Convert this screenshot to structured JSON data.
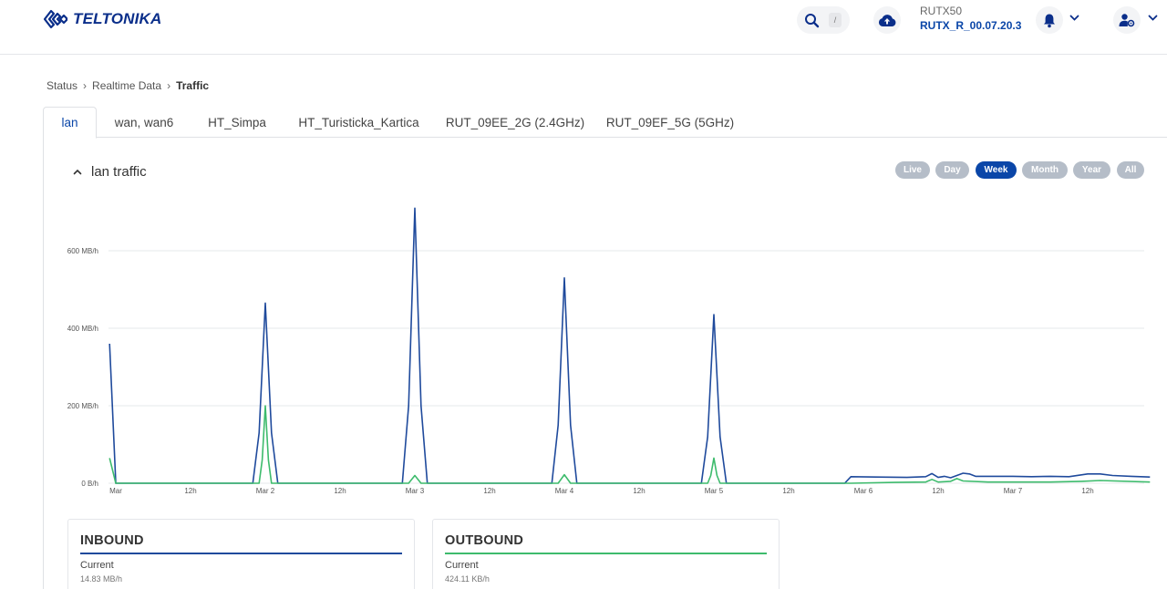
{
  "header": {
    "brand": "TELTONIKA",
    "search_shortcut": "/",
    "device_name": "RUTX50",
    "firmware": "RUTX_R_00.07.20.3"
  },
  "breadcrumb": [
    "Status",
    "Realtime Data",
    "Traffic"
  ],
  "tabs": [
    "lan",
    "wan, wan6",
    "HT_Simpa",
    "HT_Turisticka_Kartica",
    "RUT_09EE_2G (2.4GHz)",
    "RUT_09EF_5G (5GHz)"
  ],
  "active_tab": "lan",
  "panel": {
    "title": "lan traffic",
    "ranges": [
      "Live",
      "Day",
      "Week",
      "Month",
      "Year",
      "All"
    ],
    "active_range": "Week"
  },
  "colors": {
    "inbound": "#1f4a9c",
    "outbound": "#3dbb6c",
    "accent": "#0a46a8",
    "grid": "#e6e8eb"
  },
  "chart_data": {
    "type": "line",
    "y_ticks": [
      "0 B/h",
      "200 MB/h",
      "400 MB/h",
      "600 MB/h"
    ],
    "ylim": [
      0,
      720
    ],
    "y_tick_values": [
      0,
      200,
      400,
      600
    ],
    "xlim": [
      0,
      166
    ],
    "x_ticks": [
      {
        "x": 0,
        "label": "Mar"
      },
      {
        "x": 12,
        "label": "12h"
      },
      {
        "x": 24,
        "label": "Mar 2"
      },
      {
        "x": 36,
        "label": "12h"
      },
      {
        "x": 48,
        "label": "Mar 3"
      },
      {
        "x": 60,
        "label": "12h"
      },
      {
        "x": 72,
        "label": "Mar 4"
      },
      {
        "x": 84,
        "label": "12h"
      },
      {
        "x": 96,
        "label": "Mar 5"
      },
      {
        "x": 108,
        "label": "12h"
      },
      {
        "x": 120,
        "label": "Mar 6"
      },
      {
        "x": 132,
        "label": "12h"
      },
      {
        "x": 144,
        "label": "Mar 7"
      },
      {
        "x": 156,
        "label": "12h"
      }
    ],
    "series": [
      {
        "name": "Inbound",
        "color": "#1f4a9c",
        "points": [
          [
            -1,
            360
          ],
          [
            0,
            0
          ],
          [
            22,
            0
          ],
          [
            23,
            130
          ],
          [
            24,
            465
          ],
          [
            25,
            130
          ],
          [
            26,
            0
          ],
          [
            46,
            0
          ],
          [
            47,
            200
          ],
          [
            48,
            710
          ],
          [
            49,
            200
          ],
          [
            50,
            0
          ],
          [
            70,
            0
          ],
          [
            71,
            150
          ],
          [
            72,
            530
          ],
          [
            73,
            150
          ],
          [
            74,
            0
          ],
          [
            94,
            0
          ],
          [
            95,
            120
          ],
          [
            96,
            435
          ],
          [
            97,
            120
          ],
          [
            98,
            0
          ],
          [
            117,
            0
          ],
          [
            118,
            17
          ],
          [
            122,
            16
          ],
          [
            127,
            15
          ],
          [
            130,
            17
          ],
          [
            131,
            25
          ],
          [
            132,
            15
          ],
          [
            133,
            18
          ],
          [
            134,
            14
          ],
          [
            135,
            20
          ],
          [
            136,
            26
          ],
          [
            137,
            24
          ],
          [
            138,
            18
          ],
          [
            141,
            18
          ],
          [
            144,
            18
          ],
          [
            147,
            17
          ],
          [
            150,
            18
          ],
          [
            153,
            17
          ],
          [
            156,
            24
          ],
          [
            158,
            24
          ],
          [
            160,
            20
          ],
          [
            163,
            18
          ],
          [
            166,
            16
          ]
        ]
      },
      {
        "name": "Outbound",
        "color": "#3dbb6c",
        "points": [
          [
            -1,
            65
          ],
          [
            0,
            0
          ],
          [
            23,
            0
          ],
          [
            23.5,
            60
          ],
          [
            24,
            200
          ],
          [
            24.5,
            60
          ],
          [
            25,
            0
          ],
          [
            47,
            0
          ],
          [
            48,
            20
          ],
          [
            49,
            0
          ],
          [
            71,
            0
          ],
          [
            72,
            22
          ],
          [
            73,
            0
          ],
          [
            95,
            0
          ],
          [
            95.5,
            20
          ],
          [
            96,
            65
          ],
          [
            96.5,
            20
          ],
          [
            97,
            0
          ],
          [
            118,
            0
          ],
          [
            125,
            2
          ],
          [
            130,
            3
          ],
          [
            131,
            10
          ],
          [
            132,
            3
          ],
          [
            134,
            5
          ],
          [
            135,
            12
          ],
          [
            136,
            6
          ],
          [
            140,
            3
          ],
          [
            150,
            3
          ],
          [
            155,
            5
          ],
          [
            158,
            7
          ],
          [
            166,
            3
          ]
        ]
      }
    ]
  },
  "stats": {
    "inbound": {
      "title": "INBOUND",
      "label": "Current",
      "value": "14.83 MB/h"
    },
    "outbound": {
      "title": "OUTBOUND",
      "label": "Current",
      "value": "424.11 KB/h"
    }
  }
}
